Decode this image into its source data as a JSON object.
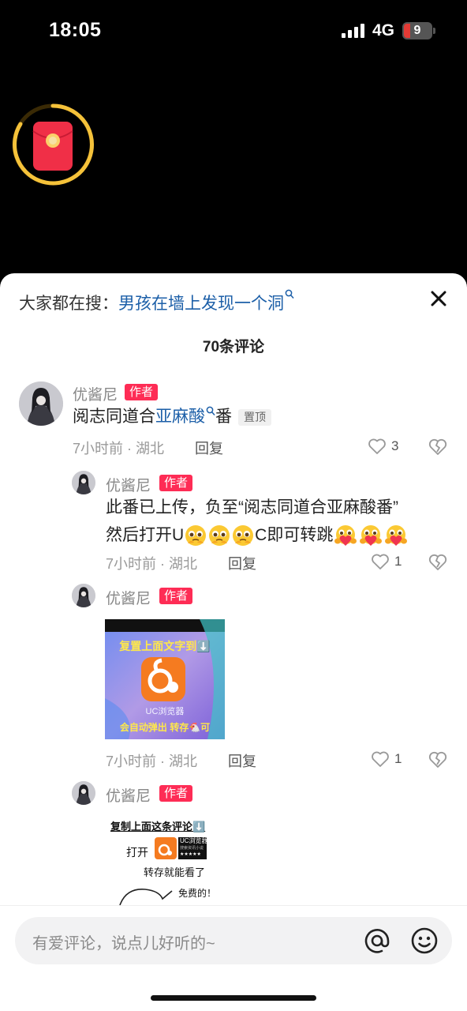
{
  "status": {
    "time": "18:05",
    "network": "4G",
    "battery": "9"
  },
  "search_tip": {
    "prefix": "大家都在搜：",
    "query": "男孩在墙上发现一个洞"
  },
  "comment_count": "70条评论",
  "author_badge": "作者",
  "pin_badge": "置顶",
  "comments": [
    {
      "user": "优酱尼",
      "text_before": "阅志同道合",
      "text_highlight": "亚麻酸",
      "text_after": "番",
      "meta": "7小时前 · 湖北",
      "reply": "回复",
      "likes": "3"
    },
    {
      "user": "优酱尼",
      "line1": "此番已上传，负至“阅志同道合亚麻酸番”",
      "line2_a": "然后打开U",
      "line2_b": "C即可转跳",
      "meta": "7小时前 · 湖北",
      "reply": "回复",
      "likes": "1"
    },
    {
      "user": "优酱尼",
      "image_top": "复置上面文字到⬇️",
      "image_app": "UC浏览器",
      "image_bottom": "会自动弹出 转存🐔可",
      "meta": "7小时前 · 湖北",
      "reply": "回复",
      "likes": "1"
    },
    {
      "user": "优酱尼",
      "card_line1": "复制上面这条评论⬇️",
      "card_open": "打开",
      "card_app": "UC浏览器",
      "card_sub": "搜索资讯小说",
      "card_line2": "转存就能看了",
      "card_line3": "免费的！"
    }
  ],
  "input": {
    "placeholder": "有爱评论，说点儿好听的~"
  },
  "colors": {
    "accent_red": "#fe2c55",
    "link_blue": "#1c5fa8",
    "uc_orange": "#f57b20"
  }
}
